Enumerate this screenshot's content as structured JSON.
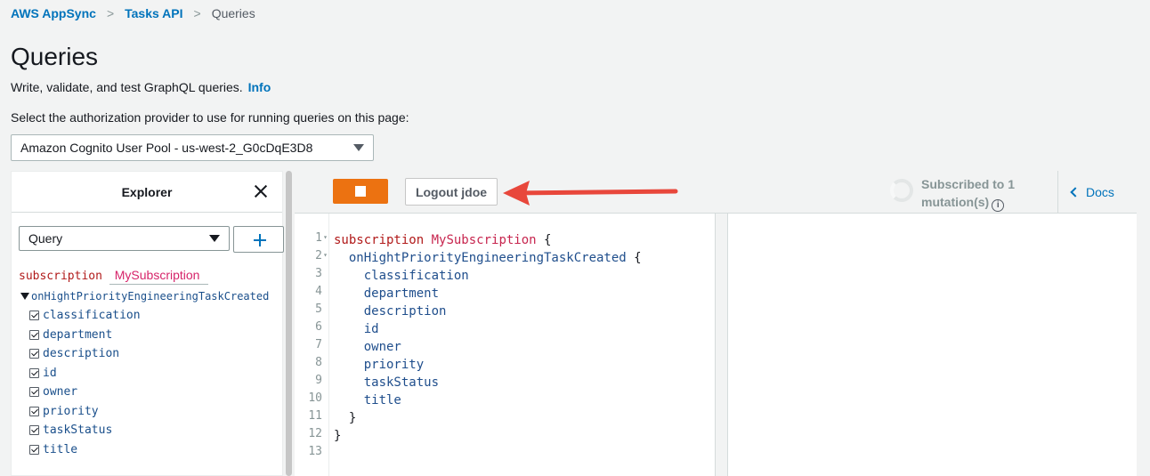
{
  "breadcrumb": {
    "items": [
      "AWS AppSync",
      "Tasks API"
    ],
    "current": "Queries"
  },
  "page": {
    "title": "Queries",
    "description": "Write, validate, and test GraphQL queries.",
    "info_link": "Info",
    "auth_label": "Select the authorization provider to use for running queries on this page:",
    "auth_provider": "Amazon Cognito User Pool - us-west-2_G0cDqE3D8"
  },
  "explorer": {
    "title": "Explorer",
    "operation_type": "Query",
    "op_keyword": "subscription",
    "op_name": "MySubscription",
    "root_field": "onHightPriorityEngineeringTaskCreated",
    "fields": [
      "classification",
      "department",
      "description",
      "id",
      "owner",
      "priority",
      "taskStatus",
      "title"
    ]
  },
  "toolbar": {
    "logout_label": "Logout jdoe",
    "status_line1": "Subscribed to 1",
    "status_line2": "mutation(s)",
    "docs_label": "Docs"
  },
  "editor": {
    "line_numbers": [
      "1",
      "2",
      "3",
      "4",
      "5",
      "6",
      "7",
      "8",
      "9",
      "10",
      "11",
      "12",
      "13"
    ],
    "keyword": "subscription",
    "name": "MySubscription",
    "root_field": "onHightPriorityEngineeringTaskCreated",
    "fields": [
      "classification",
      "department",
      "description",
      "id",
      "owner",
      "priority",
      "taskStatus",
      "title"
    ],
    "open_brace": "{",
    "close_brace": "}"
  },
  "colors": {
    "accent": "#ec7211",
    "link": "#0073bb",
    "annotation_arrow": "#e8473b"
  }
}
